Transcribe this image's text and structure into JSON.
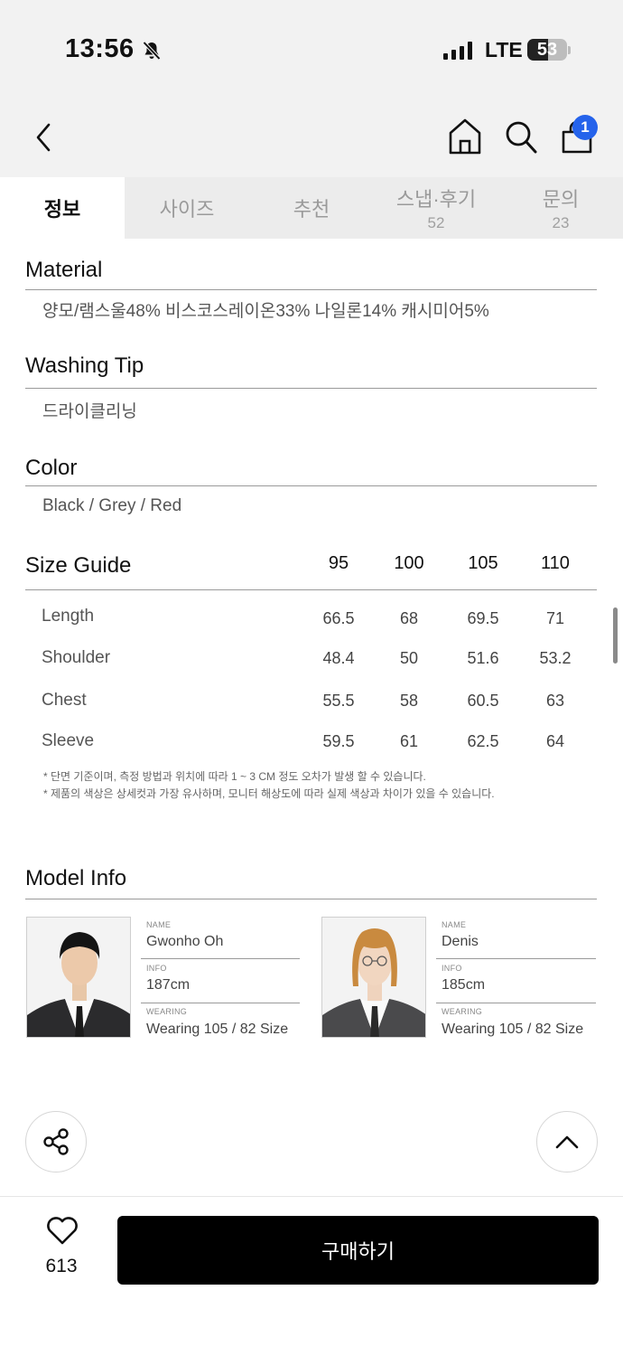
{
  "status_bar": {
    "time": "13:56",
    "network": "LTE",
    "battery": "53",
    "battery_level": 0.53
  },
  "header": {
    "cart_count": "1"
  },
  "tabs": [
    {
      "label": "정보",
      "count": ""
    },
    {
      "label": "사이즈",
      "count": ""
    },
    {
      "label": "추천",
      "count": ""
    },
    {
      "label": "스냅·후기",
      "count": "52"
    },
    {
      "label": "문의",
      "count": "23"
    }
  ],
  "material": {
    "title": "Material",
    "text": "양모/램스울48% 비스코스레이온33% 나일론14% 캐시미어5%"
  },
  "washing": {
    "title": "Washing Tip",
    "text": "드라이클리닝"
  },
  "color": {
    "title": "Color",
    "text": "Black / Grey / Red"
  },
  "size_guide": {
    "title": "Size Guide",
    "sizes": [
      "95",
      "100",
      "105",
      "110"
    ],
    "rows": [
      {
        "label": "Length",
        "values": [
          "66.5",
          "68",
          "69.5",
          "71"
        ]
      },
      {
        "label": "Shoulder",
        "values": [
          "48.4",
          "50",
          "51.6",
          "53.2"
        ]
      },
      {
        "label": "Chest",
        "values": [
          "55.5",
          "58",
          "60.5",
          "63"
        ]
      },
      {
        "label": "Sleeve",
        "values": [
          "59.5",
          "61",
          "62.5",
          "64"
        ]
      }
    ],
    "notes": [
      "* 단면 기준이며, 측정 방법과 위치에 따라 1 ~ 3 CM 정도 오차가 발생 할 수 있습니다.",
      "* 제품의 색상은 상세컷과 가장 유사하며, 모니터 해상도에 따라 실제 색상과 차이가 있을 수 있습니다."
    ]
  },
  "model_info": {
    "title": "Model Info",
    "models": [
      {
        "name_caption": "NAME",
        "name": "Gwonho Oh",
        "info_caption": "INFO",
        "info": "187cm",
        "wearing_caption": "WEARING",
        "wearing": "Wearing 105 / 82 Size"
      },
      {
        "name_caption": "NAME",
        "name": "Denis",
        "info_caption": "INFO",
        "info": "185cm",
        "wearing_caption": "WEARING",
        "wearing": "Wearing 105 / 82 Size"
      }
    ]
  },
  "bottom_bar": {
    "like_count": "613",
    "buy_label": "구매하기"
  }
}
